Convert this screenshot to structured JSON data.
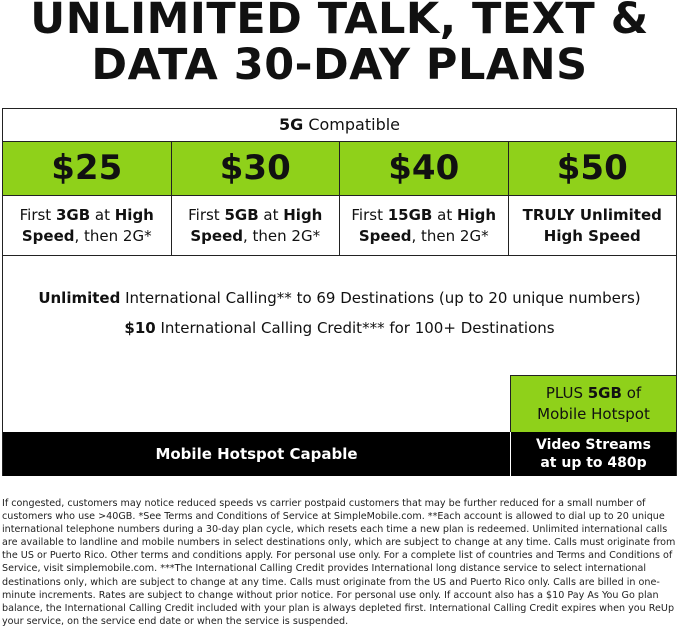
{
  "title": {
    "line1": "UNLIMITED TALK, TEXT &",
    "line2": "DATA 30-DAY PLANS"
  },
  "compat": {
    "bold": "5G",
    "rest": " Compatible"
  },
  "plans": [
    {
      "price": "$25",
      "d1": "First ",
      "d2": "3GB",
      "d3": " at ",
      "d4": "High",
      "d5": "Speed",
      "d6": ", then 2G*"
    },
    {
      "price": "$30",
      "d1": "First ",
      "d2": "5GB",
      "d3": " at ",
      "d4": "High",
      "d5": "Speed",
      "d6": ", then 2G*"
    },
    {
      "price": "$40",
      "d1": "First ",
      "d2": "15GB",
      "d3": " at ",
      "d4": "High",
      "d5": "Speed",
      "d6": ", then 2G*"
    },
    {
      "price": "$50",
      "line1": "TRULY Unlimited",
      "line2": "High Speed"
    }
  ],
  "international": {
    "l1_bold": "Unlimited",
    "l1_rest": " International Calling** to 69 Destinations (up to 20 unique numbers)",
    "l2_bold": "$10",
    "l2_rest": " International Calling Credit*** for 100+ Destinations"
  },
  "hotspot_plus": {
    "p1": "PLUS ",
    "p2": "5GB",
    "p3": " of",
    "line2": "Mobile Hotspot"
  },
  "hotspot_capable": "Mobile Hotspot Capable",
  "video": {
    "line1": "Video Streams",
    "line2": "at up to 480p"
  },
  "fine_print": "If congested, customers may notice reduced speeds vs carrier postpaid customers that may be further reduced for a small number of customers who use >40GB. *See Terms and Conditions of Service at SimpleMobile.com. **Each account is allowed to dial up to 20 unique international telephone numbers during a 30-day plan cycle, which resets each time a new plan is redeemed. Unlimited international calls are available to landline and mobile numbers in select destinations only, which are subject to change at any time. Calls must originate from the US or Puerto Rico. Other terms and conditions apply. For personal use only. For a complete list of countries and Terms and Conditions of Service, visit simplemobile.com. ***The International Calling Credit provides International long distance service to select international destinations only, which are subject to change at any time. Calls must originate from the US and Puerto Rico only. Calls are billed in one-minute increments. Rates are subject to change without prior notice. For personal use only. If account also has a $10 Pay As You Go plan balance, the International Calling Credit included with your plan is always depleted first. International Calling Credit expires when you ReUp your service, on the service end date or when the service is suspended.",
  "colors": {
    "accent_green": "#8fd11a",
    "black": "#000000"
  }
}
